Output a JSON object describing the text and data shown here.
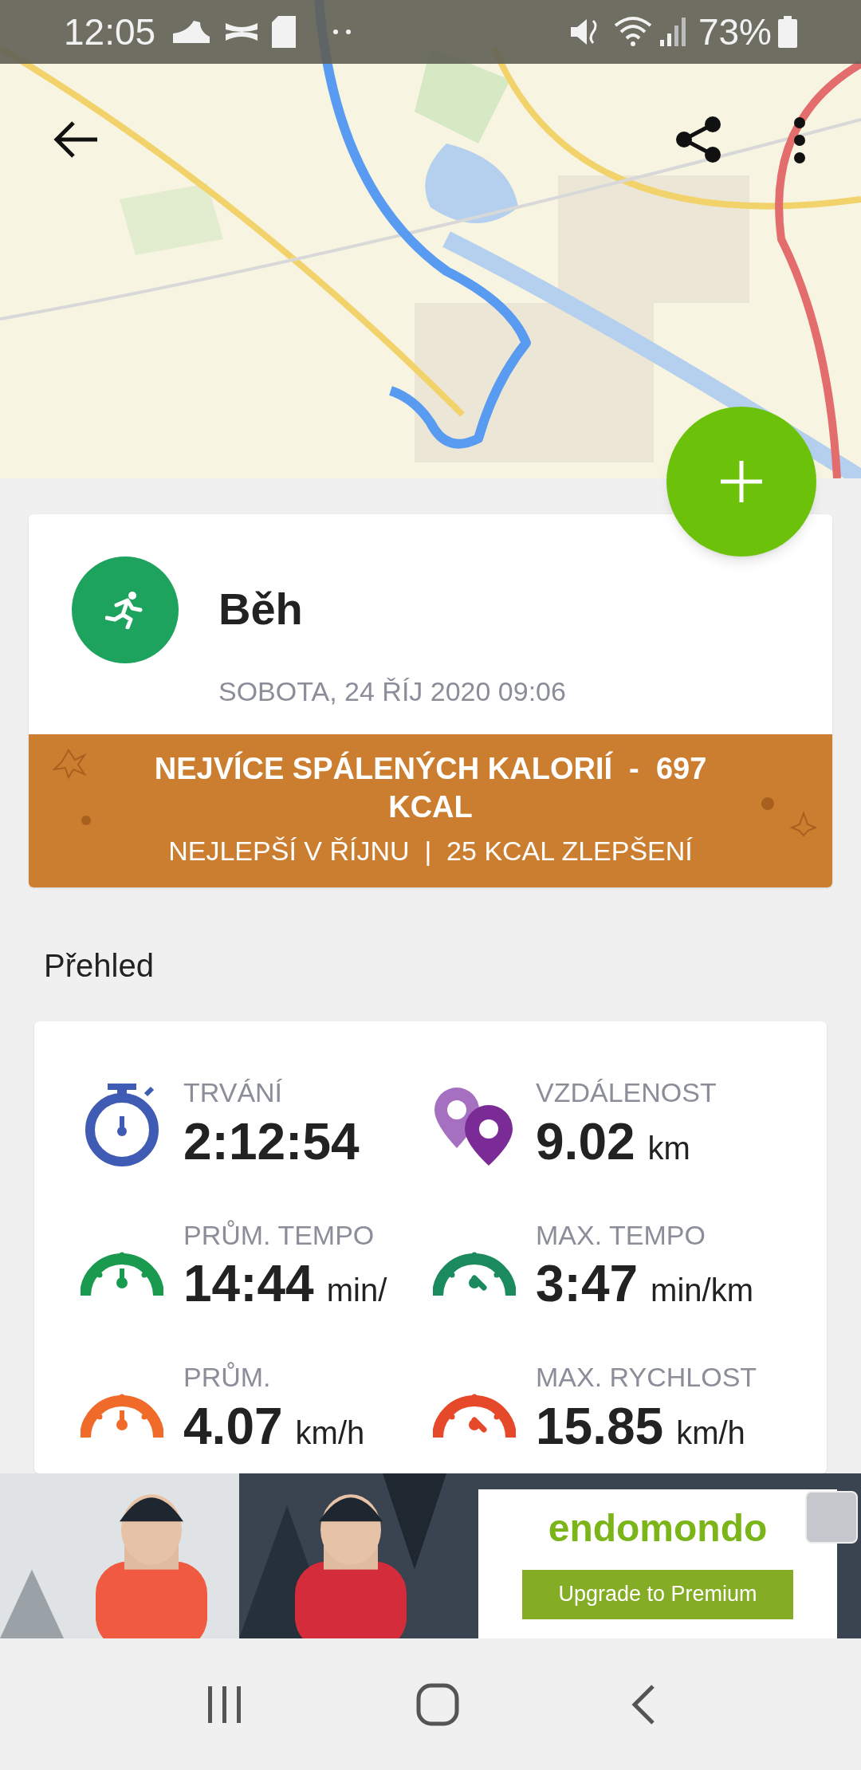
{
  "status_bar": {
    "time": "12:05",
    "battery": "73%"
  },
  "activity": {
    "title": "Běh",
    "date": "SOBOTA, 24 ŘÍJ 2020 09:06"
  },
  "achievement": {
    "headline": "NEJVÍCE SPÁLENÝCH KALORIÍ  -  697 KCAL",
    "subline": "NEJLEPŠÍ V ŘÍJNU  |  25 KCAL ZLEPŠENÍ"
  },
  "section_title": "Přehled",
  "stats": [
    {
      "kind": "duration",
      "label": "TRVÁNÍ",
      "value": "2:12:54"
    },
    {
      "kind": "distance",
      "label": "VZDÁLENOST",
      "value": "9.02",
      "unit": "km"
    },
    {
      "kind": "avg-pace",
      "label": "PRŮM. TEMPO",
      "value": "14:44",
      "unit": "min/"
    },
    {
      "kind": "max-pace",
      "label": "MAX. TEMPO",
      "value": "3:47",
      "unit": "min/km"
    },
    {
      "kind": "avg-speed",
      "label": "PRŮM.",
      "value": "4.07",
      "unit": "km/h"
    },
    {
      "kind": "max-speed",
      "label": "MAX. RYCHLOST",
      "value": "15.85",
      "unit": "km/h"
    }
  ],
  "ad": {
    "brand": "endomondo",
    "button": "Upgrade to Premium"
  }
}
